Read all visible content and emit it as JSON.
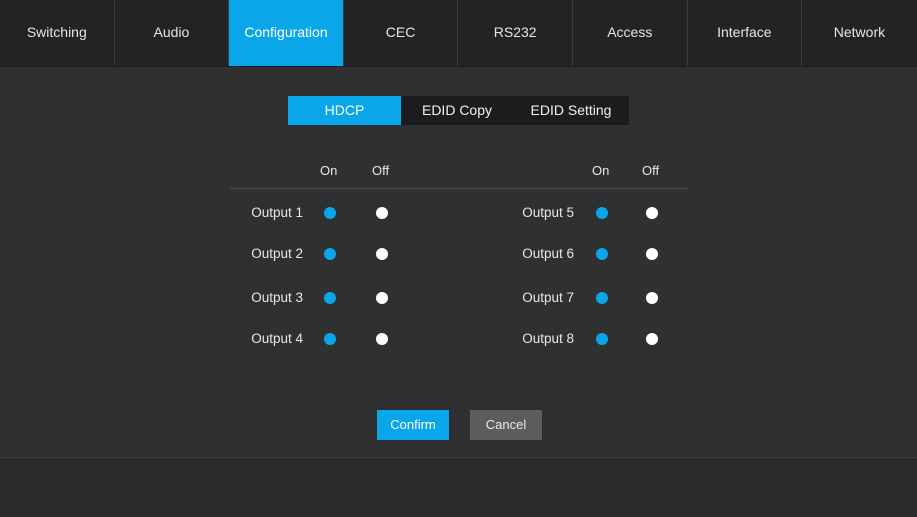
{
  "nav": {
    "tabs": [
      {
        "label": "Switching"
      },
      {
        "label": "Audio"
      },
      {
        "label": "Configuration",
        "active": true
      },
      {
        "label": "CEC"
      },
      {
        "label": "RS232"
      },
      {
        "label": "Access"
      },
      {
        "label": "Interface"
      },
      {
        "label": "Network"
      }
    ]
  },
  "subtabs": [
    {
      "label": "HDCP",
      "active": true
    },
    {
      "label": "EDID Copy"
    },
    {
      "label": "EDID Setting"
    }
  ],
  "hdcp": {
    "headers": {
      "on": "On",
      "off": "Off"
    },
    "outputs_left": [
      {
        "label": "Output 1",
        "state": "on"
      },
      {
        "label": "Output 2",
        "state": "on"
      },
      {
        "label": "Output 3",
        "state": "on"
      },
      {
        "label": "Output 4",
        "state": "on"
      }
    ],
    "outputs_right": [
      {
        "label": "Output 5",
        "state": "on"
      },
      {
        "label": "Output 6",
        "state": "on"
      },
      {
        "label": "Output 7",
        "state": "on"
      },
      {
        "label": "Output 8",
        "state": "on"
      }
    ]
  },
  "actions": {
    "confirm_label": "Confirm",
    "cancel_label": "Cancel"
  },
  "colors": {
    "accent": "#0aa6ea",
    "background": "#2f3031",
    "nav_background": "#222324"
  }
}
